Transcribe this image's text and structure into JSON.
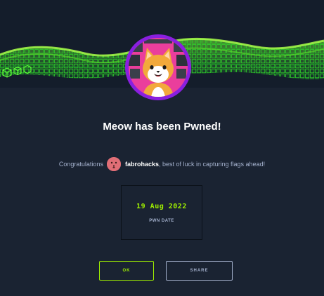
{
  "title": "Meow has been Pwned!",
  "congrats": {
    "prefix": "Congratulations",
    "username": "fabrohacks",
    "suffix": ", best of luck in capturing flags ahead!"
  },
  "pwn": {
    "date": "19 Aug 2022",
    "label": "PWN DATE"
  },
  "buttons": {
    "ok": "OK",
    "share": "SHARE"
  },
  "colors": {
    "background": "#1a2332",
    "accent_green": "#9fef00",
    "avatar_ring": "#8a1fe0",
    "muted_text": "#a4b1cd"
  },
  "icons": {
    "machine_avatar": "cat-icon",
    "banner": "green-wave-grid-icon",
    "user_avatar": "user-avatar-icon"
  }
}
